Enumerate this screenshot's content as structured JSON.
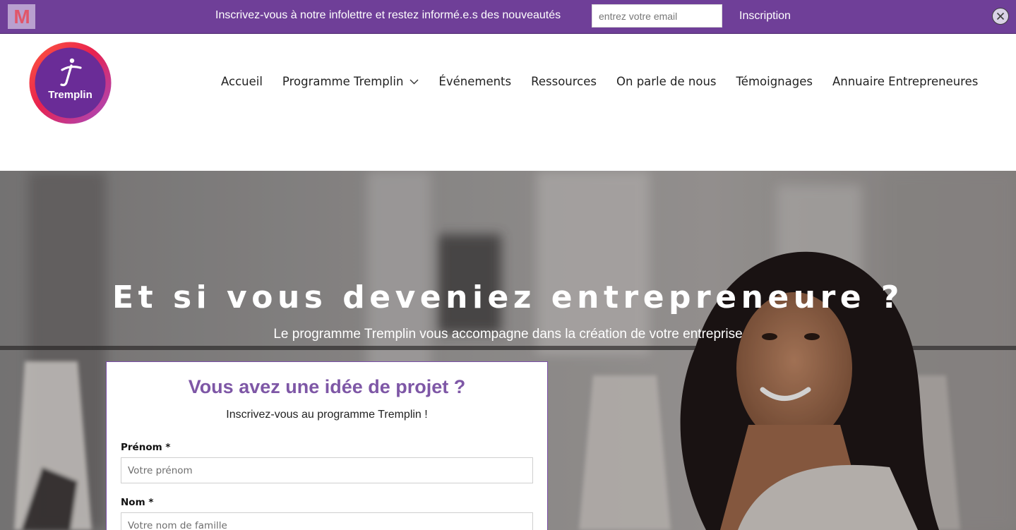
{
  "newsletter": {
    "brand_letter": "M",
    "text": "Inscrivez-vous à notre infolettre et restez informé.e.s des nouveautés",
    "email_placeholder": "entrez votre email",
    "submit_label": "Inscription",
    "background_color": "#6f3f98"
  },
  "logo": {
    "text": "Tremplin"
  },
  "nav": {
    "items": [
      {
        "label": "Accueil"
      },
      {
        "label": "Programme Tremplin",
        "has_dropdown": true
      },
      {
        "label": "Événements"
      },
      {
        "label": "Ressources"
      },
      {
        "label": "On parle de nous"
      },
      {
        "label": "Témoignages"
      },
      {
        "label": "Annuaire Entrepreneures"
      }
    ]
  },
  "hero": {
    "title": "Et si vous deveniez entrepreneure ?",
    "subtitle": "Le programme Tremplin vous accompagne dans la création de votre entreprise"
  },
  "form": {
    "title": "Vous avez une idée de projet ?",
    "subtitle": "Inscrivez-vous au programme Tremplin !",
    "first_name": {
      "label": "Prénom *",
      "placeholder": "Votre prénom"
    },
    "last_name": {
      "label": "Nom *",
      "placeholder": "Votre nom de famille"
    },
    "accent_color": "#7e57a6"
  }
}
